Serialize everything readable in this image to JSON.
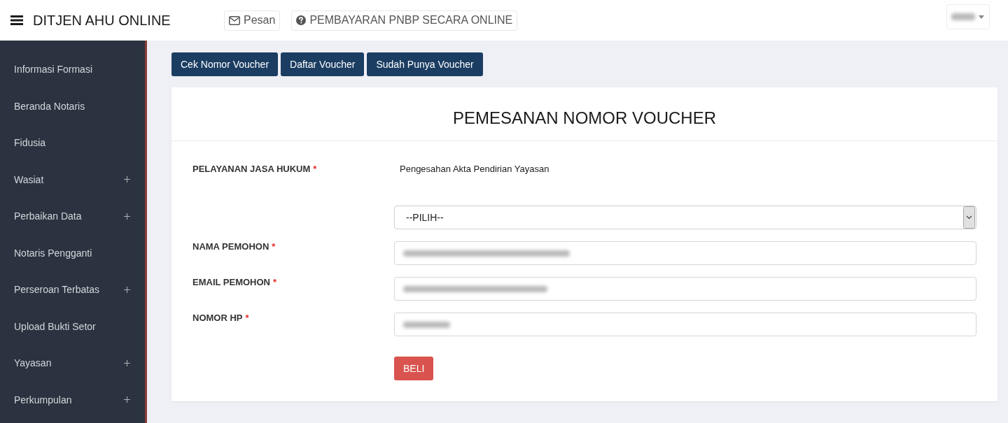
{
  "header": {
    "title": "DITJEN AHU ONLINE",
    "nav_buttons": [
      {
        "kind": "message",
        "label": "Pesan"
      },
      {
        "kind": "help",
        "label": "PEMBAYARAN PNBP SECARA ONLINE"
      }
    ],
    "user_menu": {
      "redacted": true
    }
  },
  "sidebar": {
    "items": [
      {
        "label": "Informasi Formasi",
        "expandable": false
      },
      {
        "label": "Beranda Notaris",
        "expandable": false
      },
      {
        "label": "Fidusia",
        "expandable": false
      },
      {
        "label": "Wasiat",
        "expandable": true
      },
      {
        "label": "Perbaikan Data",
        "expandable": true
      },
      {
        "label": "Notaris Pengganti",
        "expandable": false
      },
      {
        "label": "Perseroan Terbatas",
        "expandable": true
      },
      {
        "label": "Upload Bukti Setor",
        "expandable": false
      },
      {
        "label": "Yayasan",
        "expandable": true
      },
      {
        "label": "Perkumpulan",
        "expandable": true
      }
    ]
  },
  "toolbar": {
    "buttons": [
      "Cek Nomor Voucher",
      "Daftar Voucher",
      "Sudah Punya Voucher"
    ]
  },
  "card": {
    "title": "PEMESANAN NOMOR VOUCHER",
    "fields": [
      {
        "kind": "static",
        "label": "PELAYANAN JASA HUKUM",
        "required_mark": "*",
        "value": "Pengesahan Akta Pendirian Yayasan"
      },
      {
        "kind": "select",
        "value": "--PILIH--"
      },
      {
        "kind": "input",
        "label": "NAMA PEMOHON",
        "required_mark": "*",
        "redacted": true
      },
      {
        "kind": "input",
        "label": "EMAIL PEMOHON",
        "required_mark": "*",
        "redacted": true
      },
      {
        "kind": "input",
        "label": "NOMOR HP",
        "required_mark": "*",
        "redacted": true
      }
    ],
    "submit": "BELI"
  }
}
